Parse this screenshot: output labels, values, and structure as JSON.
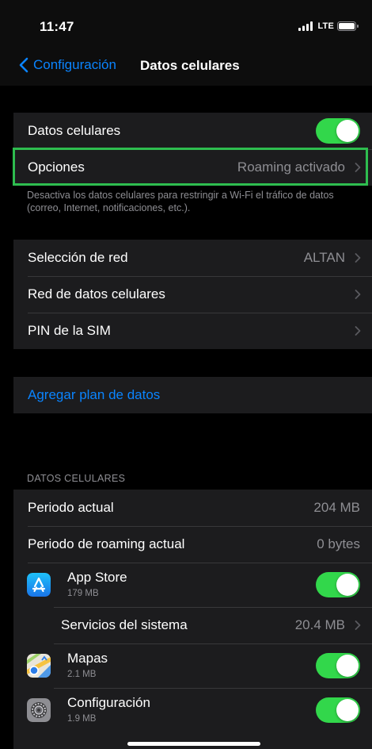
{
  "status_bar": {
    "time": "11:47",
    "network": "LTE",
    "icons": [
      "signal-icon",
      "battery-icon"
    ]
  },
  "nav": {
    "back_label": "Configuración",
    "title": "Datos celulares",
    "back_icon": "chevron-left-icon"
  },
  "group1": {
    "cellular_data": {
      "label": "Datos celulares",
      "toggle_on": true
    },
    "options": {
      "label": "Opciones",
      "value": "Roaming activado"
    },
    "footer": "Desactiva los datos celulares para restringir a Wi-Fi el tráfico de datos (correo, Internet, notificaciones, etc.)."
  },
  "group2": {
    "network_selection": {
      "label": "Selección de red",
      "value": "ALTAN"
    },
    "cellular_data_network": {
      "label": "Red de datos celulares"
    },
    "sim_pin": {
      "label": "PIN de la SIM"
    }
  },
  "group3": {
    "add_plan": {
      "label": "Agregar plan de datos"
    }
  },
  "usage": {
    "header": "DATOS CELULARES",
    "current_period": {
      "label": "Periodo actual",
      "value": "204 MB"
    },
    "roaming_period": {
      "label": "Periodo de roaming actual",
      "value": "0 bytes"
    },
    "apps": [
      {
        "name": "App Store",
        "size": "179 MB",
        "icon": "app-store-icon",
        "toggle_on": true
      },
      {
        "name": "Servicios del sistema",
        "size": "20.4 MB"
      },
      {
        "name": "Mapas",
        "size": "2.1 MB",
        "icon": "maps-icon",
        "toggle_on": true
      },
      {
        "name": "Configuración",
        "size": "1.9 MB",
        "icon": "settings-icon",
        "toggle_on": true
      }
    ]
  },
  "colors": {
    "accent": "#0a84ff",
    "toggle_on": "#32d74b",
    "highlight": "#2ebd4f",
    "cell_bg": "#1c1c1e",
    "secondary_text": "#8e8e93"
  }
}
